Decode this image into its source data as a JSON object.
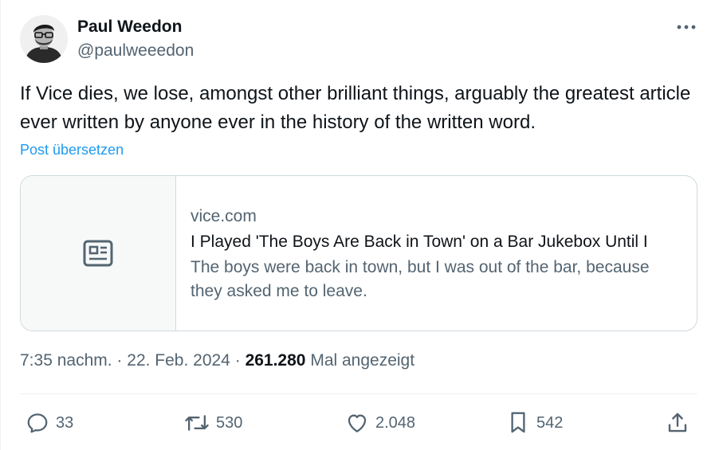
{
  "author": {
    "name": "Paul Weedon",
    "handle": "@paulweeedon"
  },
  "tweet": {
    "text": "If Vice dies, we lose, amongst other brilliant things, arguably the greatest article ever written by anyone ever in the history of the written word.",
    "translate_label": "Post übersetzen"
  },
  "card": {
    "domain": "vice.com",
    "title": "I Played 'The Boys Are Back in Town' on a Bar Jukebox Until I",
    "description": "The boys were back in town, but I was out of the bar, because they asked me to leave."
  },
  "meta": {
    "time": "7:35 nachm.",
    "separator": "·",
    "date": "22. Feb. 2024",
    "views_count": "261.280",
    "views_label": "Mal angezeigt"
  },
  "actions": {
    "replies": "33",
    "reposts": "530",
    "likes": "2.048",
    "bookmarks": "542"
  },
  "colors": {
    "accent": "#1d9bf0",
    "text": "#0f1419",
    "secondary": "#536471",
    "border": "#cfd9de"
  },
  "icons": [
    "more-icon",
    "article-icon",
    "reply-icon",
    "repost-icon",
    "like-icon",
    "bookmark-icon",
    "share-icon"
  ]
}
